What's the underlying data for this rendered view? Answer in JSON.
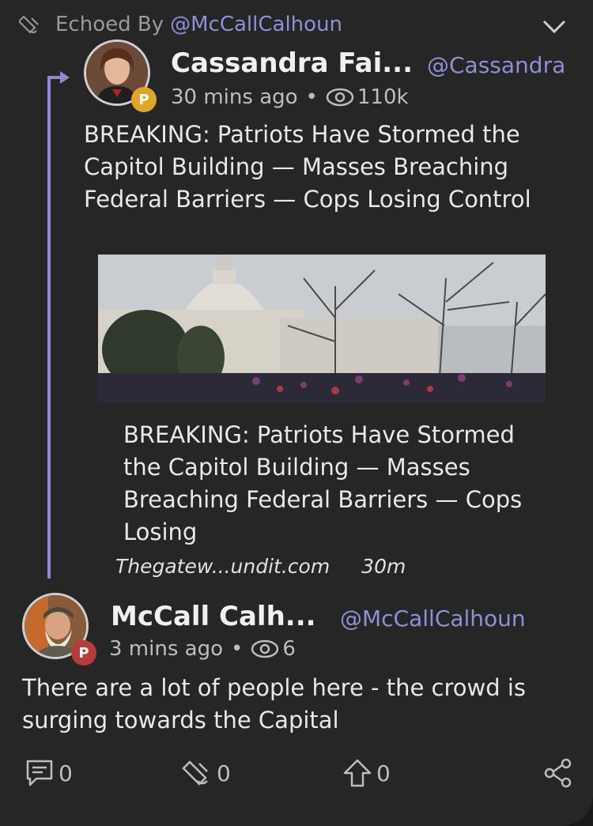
{
  "echo": {
    "label": "Echoed By",
    "user": "@McCallCalhoun"
  },
  "quoted_post": {
    "author_name": "Cassandra Fai...",
    "author_handle": "@Cassandra",
    "time": "30 mins ago",
    "views": "110k",
    "text": "BREAKING: Patriots Have Stormed the Capitol Building — Masses Breaching Federal Barriers — Cops Losing Control",
    "link": {
      "title": "BREAKING: Patriots Have Stormed the Capitol Building — Masses Breaching Federal Barriers — Cops Losing",
      "domain": "Thegatew...undit.com",
      "age": "30m"
    }
  },
  "post": {
    "author_name": "McCall Calh...",
    "author_handle": "@McCallCalhoun",
    "time": "3 mins ago",
    "views": "6",
    "text": "There are a lot of people here - the crowd is surging towards the Capital"
  },
  "actions": {
    "comments": "0",
    "echoes": "0",
    "upvotes": "0"
  },
  "badge_letter": "P",
  "colors": {
    "accent": "#8f8fd6",
    "badge_gold": "#e0a62a",
    "badge_red": "#b83a3a"
  }
}
